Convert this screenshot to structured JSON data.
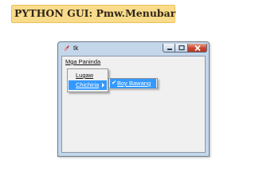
{
  "slide": {
    "title": "PYTHON GUI: Pmw.Menubar"
  },
  "window": {
    "title": "tk",
    "icons": {
      "app": "tk-feather-icon",
      "minimize": "minimize-icon",
      "maximize": "maximize-icon",
      "close": "close-icon"
    },
    "colors": {
      "frame": "#c4d6e9",
      "close": "#c9452c",
      "client": "#f0f0f0"
    }
  },
  "menubar": {
    "menu": {
      "label": "Mga Paninda",
      "items": [
        {
          "label": "Lugaw"
        },
        {
          "label": "Chichiria",
          "submenu": true,
          "highlighted": true
        }
      ]
    },
    "submenu": {
      "items": [
        {
          "label": "Boy Bawang",
          "checked": true,
          "check_mark": "✔",
          "highlighted": true
        }
      ]
    }
  },
  "colors": {
    "highlight": "#3399ff",
    "title_band": "#f9dc8b"
  }
}
